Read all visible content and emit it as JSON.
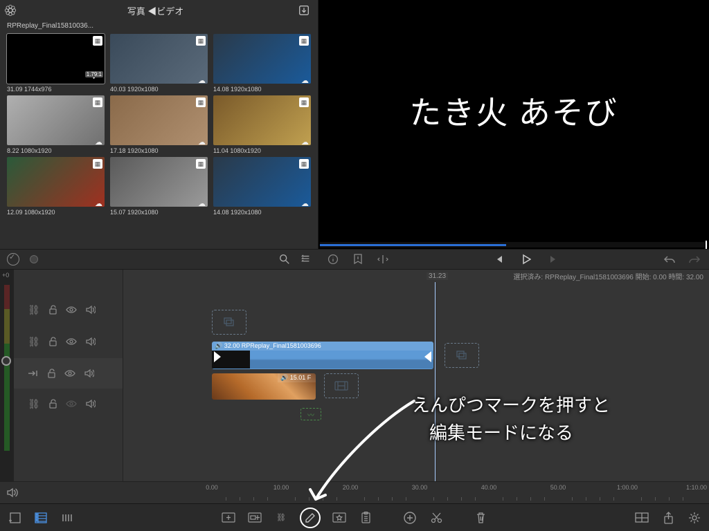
{
  "browser": {
    "back_icon": "photos-app-icon",
    "title": "写真 ◀ビデオ",
    "download_icon": "download-icon",
    "filename": "RPReplay_Final15810036...",
    "thumbs": [
      {
        "duration": "31.09",
        "res": "1744x976",
        "aspect": "1.79:1",
        "selected": true
      },
      {
        "duration": "40.03",
        "res": "1920x1080",
        "cloud": true
      },
      {
        "duration": "14.08",
        "res": "1920x1080",
        "cloud": true
      },
      {
        "duration": "8.22",
        "res": "1080x1920",
        "cloud": true
      },
      {
        "duration": "17.18",
        "res": "1920x1080",
        "cloud": true
      },
      {
        "duration": "11.04",
        "res": "1080x1920",
        "cloud": true
      },
      {
        "duration": "12.09",
        "res": "1080x1920",
        "cloud": true
      },
      {
        "duration": "15.07",
        "res": "1920x1080",
        "cloud": true
      },
      {
        "duration": "14.08",
        "res": "1920x1080",
        "cloud": true
      }
    ]
  },
  "preview": {
    "title_text": "たき火 あそび",
    "progress": 0.48
  },
  "mid": {
    "meter_label": "+0"
  },
  "timeline": {
    "playhead_time": "31.23",
    "status": "選択済み: RPReplay_Final1581003696 開始: 0.00 時間: 32.00",
    "clip1": {
      "label": "🔊 32.00  RPReplay_Final1581003696"
    },
    "clip2": {
      "label": "🔊 15.01  F"
    },
    "ruler": [
      "0.00",
      "10.00",
      "20.00",
      "30.00",
      "40.00",
      "50.00",
      "1:00.00",
      "1:10.00"
    ]
  },
  "annotation": {
    "line1": "えんぴつマークを押すと",
    "line2": "編集モードになる"
  },
  "thumb_colors": [
    "#000000",
    "linear-gradient(135deg,#3a4a5a,#5a6a7a)",
    "linear-gradient(135deg,#2a3a4a,#1a5a9a)",
    "linear-gradient(135deg,#b0b0b0,#707070)",
    "linear-gradient(135deg,#8a6a4a,#b09070)",
    "linear-gradient(135deg,#7a5a2a,#c0a050)",
    "linear-gradient(135deg,#2a5a3a,#a03020)",
    "linear-gradient(135deg,#5a5a5a,#9a9a9a)",
    "linear-gradient(135deg,#2a3a4a,#1a5a9a)"
  ]
}
